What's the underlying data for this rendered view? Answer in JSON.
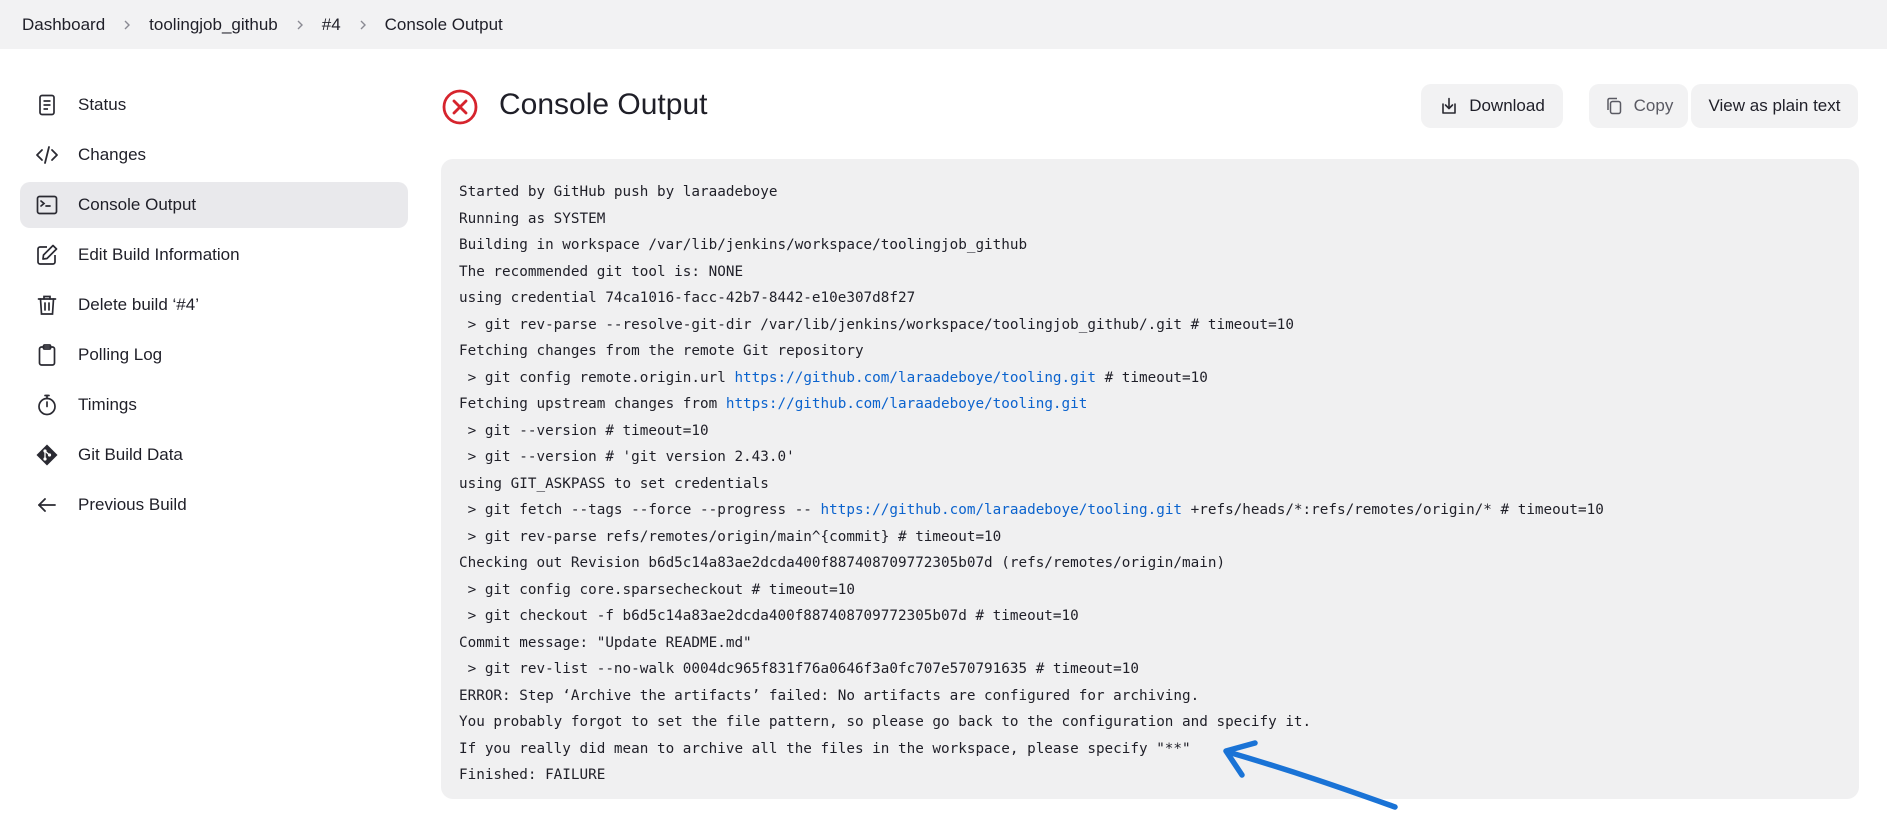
{
  "breadcrumb": [
    "Dashboard",
    "toolingjob_github",
    "#4",
    "Console Output"
  ],
  "sidebar": {
    "items": [
      {
        "label": "Status",
        "icon": "document-icon"
      },
      {
        "label": "Changes",
        "icon": "code-icon"
      },
      {
        "label": "Console Output",
        "icon": "terminal-icon"
      },
      {
        "label": "Edit Build Information",
        "icon": "edit-icon"
      },
      {
        "label": "Delete build ‘#4’",
        "icon": "trash-icon"
      },
      {
        "label": "Polling Log",
        "icon": "clipboard-icon"
      },
      {
        "label": "Timings",
        "icon": "stopwatch-icon"
      },
      {
        "label": "Git Build Data",
        "icon": "git-icon"
      },
      {
        "label": "Previous Build",
        "icon": "arrow-left-icon"
      }
    ]
  },
  "header": {
    "title": "Console Output",
    "status_icon": "error-circle-icon",
    "status_color": "#d6242d",
    "buttons": {
      "download": "Download",
      "copy": "Copy",
      "plain": "View as plain text"
    }
  },
  "console": {
    "link_color": "#0b63ce",
    "lines": [
      {
        "segments": [
          {
            "text": "Started by GitHub push by laraadeboye"
          }
        ]
      },
      {
        "segments": [
          {
            "text": "Running as SYSTEM"
          }
        ]
      },
      {
        "segments": [
          {
            "text": "Building in workspace /var/lib/jenkins/workspace/toolingjob_github"
          }
        ]
      },
      {
        "segments": [
          {
            "text": "The recommended git tool is: NONE"
          }
        ]
      },
      {
        "segments": [
          {
            "text": "using credential 74ca1016-facc-42b7-8442-e10e307d8f27"
          }
        ]
      },
      {
        "segments": [
          {
            "text": " > git rev-parse --resolve-git-dir /var/lib/jenkins/workspace/toolingjob_github/.git # timeout=10"
          }
        ]
      },
      {
        "segments": [
          {
            "text": "Fetching changes from the remote Git repository"
          }
        ]
      },
      {
        "segments": [
          {
            "text": " > git config remote.origin.url "
          },
          {
            "text": "https://github.com/laraadeboye/tooling.git",
            "link": true
          },
          {
            "text": " # timeout=10"
          }
        ]
      },
      {
        "segments": [
          {
            "text": "Fetching upstream changes from "
          },
          {
            "text": "https://github.com/laraadeboye/tooling.git",
            "link": true
          }
        ]
      },
      {
        "segments": [
          {
            "text": " > git --version # timeout=10"
          }
        ]
      },
      {
        "segments": [
          {
            "text": " > git --version # 'git version 2.43.0'"
          }
        ]
      },
      {
        "segments": [
          {
            "text": "using GIT_ASKPASS to set credentials"
          }
        ]
      },
      {
        "segments": [
          {
            "text": " > git fetch --tags --force --progress -- "
          },
          {
            "text": "https://github.com/laraadeboye/tooling.git",
            "link": true
          },
          {
            "text": " +refs/heads/*:refs/remotes/origin/* # timeout=10"
          }
        ]
      },
      {
        "segments": [
          {
            "text": " > git rev-parse refs/remotes/origin/main^{commit} # timeout=10"
          }
        ]
      },
      {
        "segments": [
          {
            "text": "Checking out Revision b6d5c14a83ae2dcda400f887408709772305b07d (refs/remotes/origin/main)"
          }
        ]
      },
      {
        "segments": [
          {
            "text": " > git config core.sparsecheckout # timeout=10"
          }
        ]
      },
      {
        "segments": [
          {
            "text": " > git checkout -f b6d5c14a83ae2dcda400f887408709772305b07d # timeout=10"
          }
        ]
      },
      {
        "segments": [
          {
            "text": "Commit message: \"Update README.md\""
          }
        ]
      },
      {
        "segments": [
          {
            "text": " > git rev-list --no-walk 0004dc965f831f76a0646f3a0fc707e570791635 # timeout=10"
          }
        ]
      },
      {
        "segments": [
          {
            "text": "ERROR: Step ‘Archive the artifacts’ failed: No artifacts are configured for archiving."
          }
        ]
      },
      {
        "segments": [
          {
            "text": "You probably forgot to set the file pattern, so please go back to the configuration and specify it."
          }
        ]
      },
      {
        "segments": [
          {
            "text": "If you really did mean to archive all the files in the workspace, please specify \"**\""
          }
        ]
      },
      {
        "segments": [
          {
            "text": "Finished: FAILURE"
          }
        ]
      }
    ]
  },
  "annotation": {
    "arrow_color": "#1a73d6"
  }
}
